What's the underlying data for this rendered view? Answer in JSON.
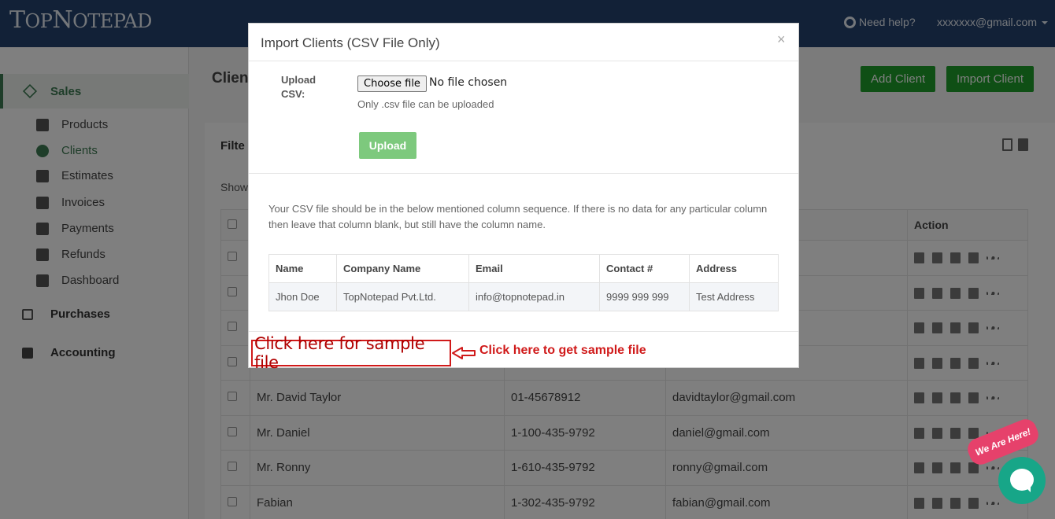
{
  "topbar": {
    "logo_big": "T",
    "logo_rest_1": "OP",
    "logo_big2": "N",
    "logo_rest_2": "OTEPAD",
    "help_label": "Need help?",
    "user_email": "xxxxxxx@gmail.com"
  },
  "sidebar": {
    "sales_label": "Sales",
    "items": [
      {
        "label": "Products",
        "icon": "cubes-icon"
      },
      {
        "label": "Clients",
        "icon": "users-icon"
      },
      {
        "label": "Estimates",
        "icon": "file-icon"
      },
      {
        "label": "Invoices",
        "icon": "file-outline-icon"
      },
      {
        "label": "Payments",
        "icon": "credit-card-icon"
      },
      {
        "label": "Refunds",
        "icon": "exchange-icon"
      },
      {
        "label": "Dashboard",
        "icon": "dashboard-icon"
      }
    ],
    "purchases_label": "Purchases",
    "accounting_label": "Accounting"
  },
  "main": {
    "page_title": "Client",
    "add_client_label": "Add Client",
    "import_client_label": "Import Client",
    "filter_title": "Filte",
    "show_label": "Show",
    "table_header_action": "Action",
    "rows": [
      {
        "name": "",
        "phone": "",
        "email": ""
      },
      {
        "name": "",
        "phone": "",
        "email": ""
      },
      {
        "name": "",
        "phone": "",
        "email": ""
      },
      {
        "name": "",
        "phone": "",
        "email": ""
      },
      {
        "name": "Mr. David Taylor",
        "phone": "01-45678912",
        "email": "davidtaylor@gmail.com"
      },
      {
        "name": "Mr. Daniel",
        "phone": "1-100-435-9792",
        "email": "daniel@gmail.com"
      },
      {
        "name": "Mr. Ronny",
        "phone": "1-610-435-9792",
        "email": "ronny@gmail.com"
      },
      {
        "name": "Fabian",
        "phone": "1-302-435-9792",
        "email": "fabian@gmail.com"
      }
    ]
  },
  "modal": {
    "title": "Import Clients (CSV File Only)",
    "close_label": "×",
    "upload_label": "Upload CSV:",
    "choose_file_label": "Choose file",
    "no_file_text": "No file chosen",
    "csv_note": "Only .csv file can be uploaded",
    "upload_button": "Upload",
    "sequence_note": "Your CSV file should be in the below mentioned column sequence. If there is no data for any particular column then leave that column blank, but still have the column name.",
    "sample_headers": [
      "Name",
      "Company Name",
      "Email",
      "Contact #",
      "Address"
    ],
    "sample_row": [
      "Jhon Doe",
      "TopNotepad Pvt.Ltd.",
      "info@topnotepad.in",
      "9999 999 999",
      "Test Address"
    ],
    "sample_link_label": "Click here for sample file",
    "annotation": "Click here to get sample file"
  },
  "chat": {
    "badge": "We Are Here!"
  },
  "colors": {
    "topbar": "#25426f",
    "accent_green": "#1e9e2a",
    "sidebar_active": "#3d7a52",
    "annotation_red": "#d01a1a",
    "chat_teal": "#17a688"
  }
}
